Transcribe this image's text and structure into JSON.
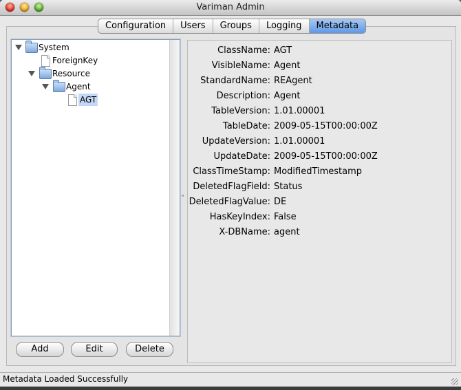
{
  "window": {
    "title": "Variman Admin"
  },
  "tabs": [
    {
      "label": "Configuration",
      "active": false
    },
    {
      "label": "Users",
      "active": false
    },
    {
      "label": "Groups",
      "active": false
    },
    {
      "label": "Logging",
      "active": false
    },
    {
      "label": "Metadata",
      "active": true
    }
  ],
  "tree": {
    "system": "System",
    "foreign_key": "ForeignKey",
    "resource": "Resource",
    "agent": "Agent",
    "agt": "AGT"
  },
  "buttons": {
    "add": "Add",
    "edit": "Edit",
    "delete": "Delete"
  },
  "properties": [
    {
      "key": "ClassName:",
      "value": "AGT"
    },
    {
      "key": "VisibleName:",
      "value": "Agent"
    },
    {
      "key": "StandardName:",
      "value": "REAgent"
    },
    {
      "key": "Description:",
      "value": "Agent"
    },
    {
      "key": "TableVersion:",
      "value": "1.01.00001"
    },
    {
      "key": "TableDate:",
      "value": "2009-05-15T00:00:00Z"
    },
    {
      "key": "UpdateVersion:",
      "value": "1.01.00001"
    },
    {
      "key": "UpdateDate:",
      "value": "2009-05-15T00:00:00Z"
    },
    {
      "key": "ClassTimeStamp:",
      "value": "ModifiedTimestamp"
    },
    {
      "key": "DeletedFlagField:",
      "value": "Status"
    },
    {
      "key": "DeletedFlagValue:",
      "value": "DE"
    },
    {
      "key": "HasKeyIndex:",
      "value": "False"
    },
    {
      "key": "X-DBName:",
      "value": "agent"
    }
  ],
  "status": {
    "text": "Metadata Loaded Successfully"
  },
  "colors": {
    "tab_active": "#5f98e6",
    "selection": "#c3d8f6"
  }
}
